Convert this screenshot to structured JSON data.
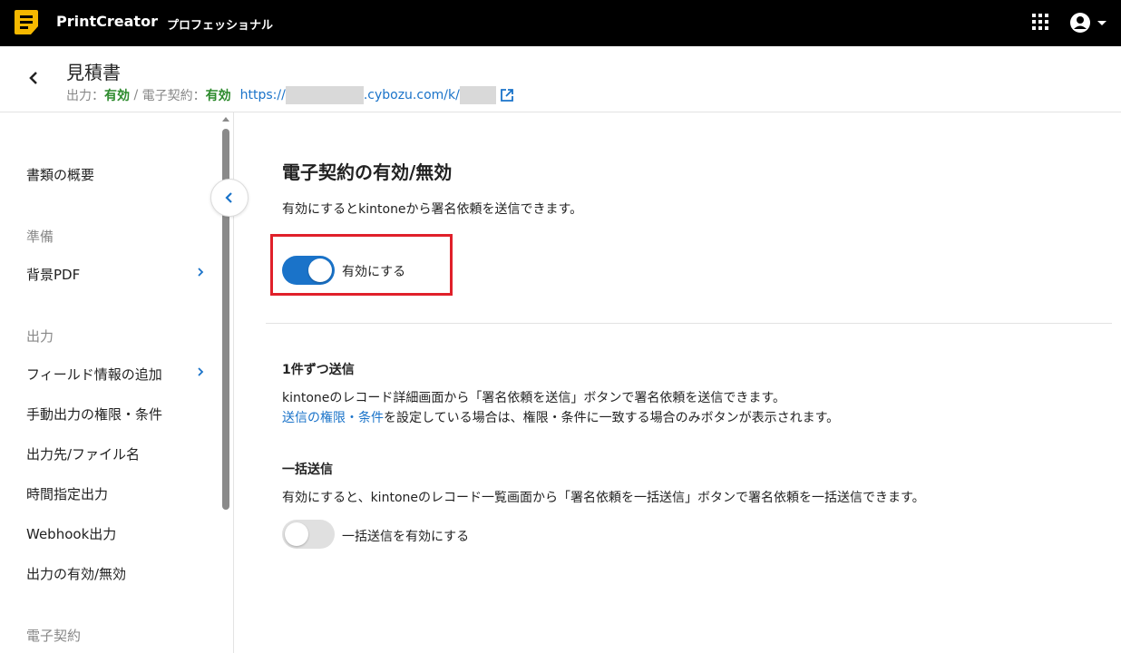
{
  "app": {
    "name": "PrintCreator",
    "edition": "プロフェッショナル",
    "brand_color": "#f5b800",
    "icons": [
      "apps-grid-icon",
      "account-icon",
      "caret-down-icon"
    ]
  },
  "header": {
    "title": "見積書",
    "output_label": "出力：",
    "output_value": "有効",
    "separator": " / ",
    "esign_label": "電子契約：",
    "esign_value": "有効",
    "url_prefix": "https://",
    "url_middle": ".cybozu.com/k/",
    "status_color": "#2c8a2c",
    "link_color": "#1a73c9"
  },
  "sidebar": {
    "items": [
      {
        "label": "書類の概要"
      },
      {
        "section": "準備"
      },
      {
        "label": "背景PDF",
        "has_children": true
      },
      {
        "section": "出力"
      },
      {
        "label": "フィールド情報の追加",
        "has_children": true
      },
      {
        "label": "手動出力の権限・条件"
      },
      {
        "label": "出力先/ファイル名"
      },
      {
        "label": "時間指定出力"
      },
      {
        "label": "Webhook出力"
      },
      {
        "label": "出力の有効/無効"
      },
      {
        "section": "電子契約"
      }
    ]
  },
  "main": {
    "title": "電子契約の有効/無効",
    "description": "有効にするとkintoneから署名依頼を送信できます。",
    "enable_toggle": {
      "label": "有効にする",
      "checked": true
    },
    "single_send": {
      "title": "1件ずつ送信",
      "line1": "kintoneのレコード詳細画面から「署名依頼を送信」ボタンで署名依頼を送信できます。",
      "link_text": "送信の権限・条件",
      "line2_rest": "を設定している場合は、権限・条件に一致する場合のみボタンが表示されます。"
    },
    "bulk_send": {
      "title": "一括送信",
      "line1": "有効にすると、kintoneのレコード一覧画面から「署名依頼を一括送信」ボタンで署名依頼を一括送信できます。",
      "toggle_label": "一括送信を有効にする",
      "checked": false
    },
    "highlight_color": "#e0202a",
    "toggle_on_color": "#1a73c9"
  }
}
